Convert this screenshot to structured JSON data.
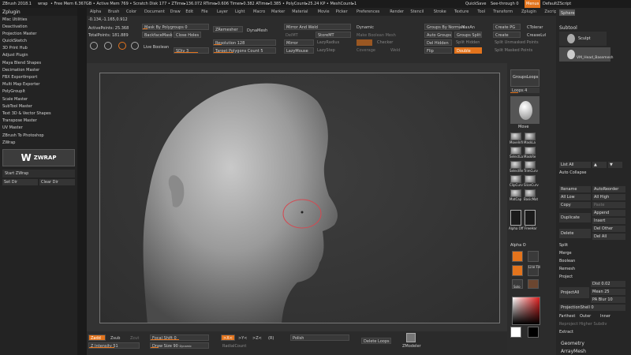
{
  "titlebar": {
    "app": "ZBrush 2018.1",
    "doc": "wrap",
    "stats": "• Free Mem 6.367GB • Active Mem 769 • Scratch Disk 177 • ZTime▸136.072 RTime▸0.606 Timer▸0.382 ATime▸0.385 • PolyCount▸25.24 KP • MeshCount▸1",
    "quicksave": "QuickSave",
    "seethrough": "See-through  0",
    "menus": "Menus",
    "script": "DefaultZScript"
  },
  "menus": [
    "Alpha",
    "Brush",
    "Color",
    "Document",
    "Draw",
    "Edit",
    "File",
    "Layer",
    "Light",
    "Macro",
    "Marker",
    "Material",
    "Movie",
    "Picker",
    "Preferences",
    "Render",
    "Stencil",
    "Stroke",
    "Texture",
    "Tool",
    "Transform",
    "Zplugin",
    "Zscript"
  ],
  "zplugin": {
    "header": "Zplugin",
    "items": [
      "Misc Utilities",
      "Deactivation",
      "Projection Master",
      "QuickSketch",
      "3D Print Hub",
      "Adjust Plugin",
      "Maya Blend Shapes",
      "Decimation Master",
      "FBX ExportImport",
      "Multi Map Exporter",
      "PolyGroupIt",
      "Scale Master",
      "SubTool Master",
      "Text 3D & Vector Shapes",
      "Transpose Master",
      "UV Master",
      "ZBrush To Photoshop",
      "ZWrap"
    ],
    "zwrap_logo": "ZWRAP",
    "start": "Start ZWrap",
    "set_dir": "Set Dir",
    "clear_dir": "Clear Dir"
  },
  "top": {
    "coords": "-0.134,-1.165,0.912",
    "active_points": "ActivePoints: 25.368",
    "total_points": "TotalPoints: 181.889",
    "mask_polygroups": "Mask By Polygroups 0",
    "backface_mask": "BackfaceMask",
    "close_holes": "Close Holes",
    "live_boolean": "Live Boolean",
    "sdiv": "SDiv 3",
    "zremesher": "ZRemesher",
    "dynamesh": "DynaMesh",
    "resolution": "Resolution 128",
    "target_polygons": "Target Polygons Count 5",
    "mirror_weld": "Mirror And Weld",
    "delmt": "DelMT",
    "storemt": "StoreMT",
    "mirror": "Mirror",
    "lazymouse": "LazyMouse",
    "lazyradius": "LazyRadius",
    "lazystep": "LazyStep",
    "dynamic": "Dynamic",
    "make_boolean_mesh": "Make Boolean Mesh",
    "checker": "Checker",
    "groups_by_normals": "Groups By Normals",
    "maxang": "MaxAn",
    "auto_groups": "Auto Groups",
    "groups_split": "Groups Split",
    "del_hidden": "Del Hidden",
    "split_hidden": "Split Hidden",
    "flip": "Flip",
    "double": "Double",
    "create_pg": "Create PG",
    "ctolerance": "CTolerar",
    "create": "Create",
    "crease_lv": "CreaseLvl",
    "split_unmasked": "Split Unmasked Points",
    "split_masked": "Split Masked Points",
    "coverage": "Coverage",
    "weld": "Weld"
  },
  "shelf": {
    "groups_loops": "GroupsLoops",
    "loops": "Loops 4",
    "move": "Move",
    "brushes": [
      "MoveInfi",
      "MaskLa",
      "SelectLa",
      "MaskRe",
      "SelectRe",
      "TrimCurv",
      "ClipCurv",
      "SliceCurv",
      "MatCap",
      "BasicMat",
      "Alpha Off",
      "FreeHar"
    ],
    "alpha": "Alpha O",
    "line_fill": "Line Fill",
    "persp": "Persp",
    "solo": "Solo"
  },
  "right": {
    "sphere": "Sphere",
    "subtool_header": "Subtool",
    "sculpt": "Sculpt",
    "mesh_name": "VM_Head_Basemesh",
    "list_all": "List All",
    "auto_collapse": "Auto Collapse",
    "rename": "Rename",
    "auto_reorder": "AutoReorder",
    "all_low": "All Low",
    "all_high": "All High",
    "copy": "Copy",
    "paste": "Paste",
    "duplicate": "Duplicate",
    "append": "Append",
    "insert": "Insert",
    "delete": "Delete",
    "del_other": "Del Other",
    "del_all": "Del All",
    "split": "Split",
    "merge": "Merge",
    "boolean": "Boolean",
    "remesh": "Remesh",
    "project": "Project",
    "dist": "Dist 0.02",
    "project_all": "ProjectAll",
    "mean": "Mean 25",
    "pa_blur": "PA Blur 10",
    "project_shell": "ProjectionShell 0",
    "farthest": "Farthest",
    "outer": "Outer",
    "inner": "Inner",
    "reproject": "Reproject Higher Subdiv",
    "extract": "Extract",
    "geometry": "Geometry",
    "arraymesh": "ArrayMesh"
  },
  "bottom": {
    "zadd": "Zadd",
    "zsub": "Zsub",
    "zcut": "Zcut",
    "focal_shift": "Focal Shift 0",
    "z_intensity": "Z Intensity 51",
    "draw_size": "Draw Size 90",
    "dynamic": "Dynamic",
    "x_axis": ">X<",
    "y_axis": ">Y<",
    "z_axis": ">Z<",
    "r": "(R)",
    "radial_count": "RadialCount",
    "polish": "Polish",
    "delete_loops": "Delete Loops",
    "zmodeler": "ZModeler"
  },
  "colors": {
    "accent": "#e3741d",
    "bg": "#2a2a2a"
  }
}
